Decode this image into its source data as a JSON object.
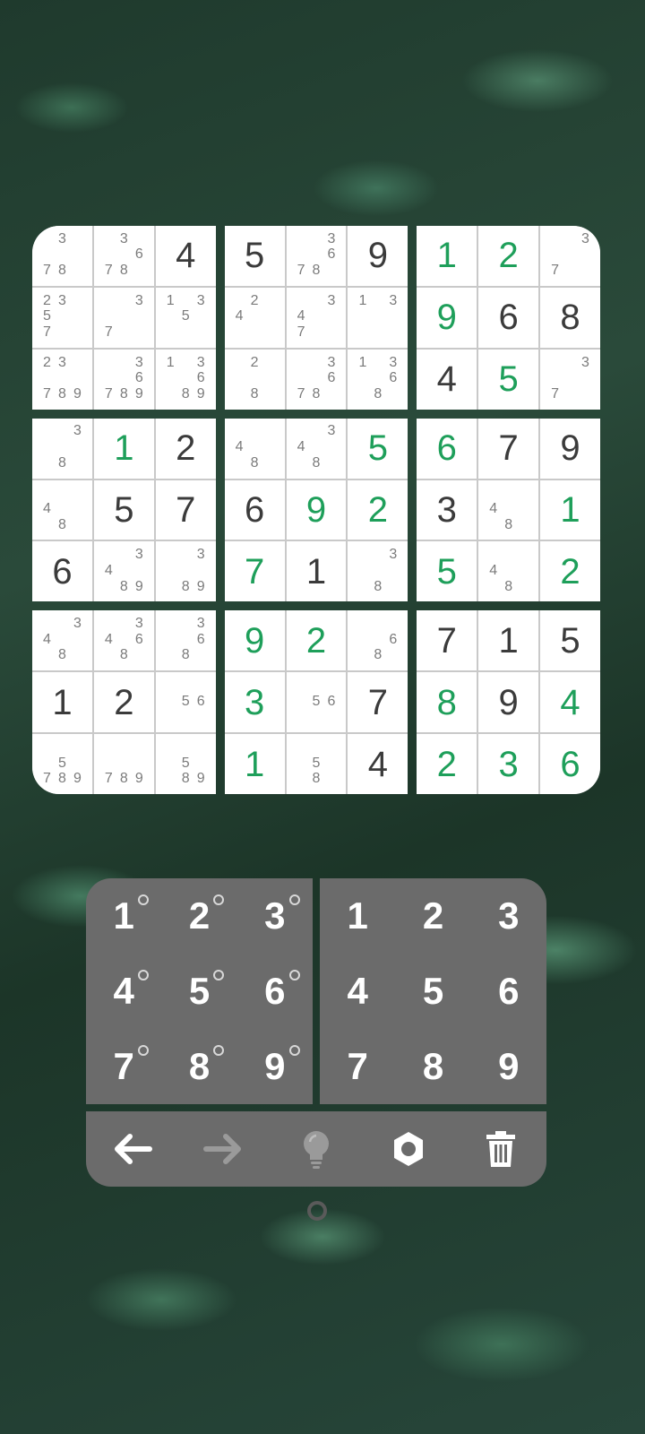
{
  "board": [
    [
      {
        "notes": [
          "",
          "3",
          "",
          "",
          "",
          "",
          "7",
          "8",
          ""
        ]
      },
      {
        "notes": [
          "",
          "3",
          "",
          "",
          "",
          "6",
          "7",
          "8",
          ""
        ]
      },
      {
        "value": "4",
        "kind": "given"
      },
      {
        "notes": [
          "2",
          "3",
          "",
          "5",
          "",
          "",
          "7",
          "",
          ""
        ]
      },
      {
        "notes": [
          "",
          "",
          "3",
          "",
          "",
          "",
          "7",
          "",
          ""
        ]
      },
      {
        "notes": [
          "1",
          "",
          "3",
          "",
          "5",
          "",
          "",
          "",
          ""
        ]
      },
      {
        "notes": [
          "2",
          "3",
          "",
          "",
          "",
          "",
          "7",
          "8",
          "9"
        ]
      },
      {
        "notes": [
          "",
          "",
          "3",
          "",
          "",
          "6",
          "7",
          "8",
          "9"
        ]
      },
      {
        "notes": [
          "1",
          "",
          "3",
          "",
          "",
          "6",
          "",
          "8",
          "9"
        ]
      }
    ],
    [
      {
        "value": "5",
        "kind": "given"
      },
      {
        "notes": [
          "",
          "",
          "3",
          "",
          "",
          "6",
          "7",
          "8",
          ""
        ]
      },
      {
        "value": "9",
        "kind": "given"
      },
      {
        "notes": [
          "",
          "2",
          "",
          "4",
          "",
          "",
          "",
          "",
          ""
        ]
      },
      {
        "notes": [
          "",
          "",
          "3",
          "4",
          "",
          "",
          "7",
          "",
          ""
        ]
      },
      {
        "notes": [
          "1",
          "",
          "3",
          "",
          "",
          "",
          "",
          "",
          ""
        ]
      },
      {
        "notes": [
          "",
          "2",
          "",
          "",
          "",
          "",
          "",
          "8",
          ""
        ]
      },
      {
        "notes": [
          "",
          "",
          "3",
          "",
          "",
          "6",
          "7",
          "8",
          ""
        ]
      },
      {
        "notes": [
          "1",
          "",
          "3",
          "",
          "",
          "6",
          "",
          "8",
          ""
        ]
      }
    ],
    [
      {
        "value": "1",
        "kind": "user"
      },
      {
        "value": "2",
        "kind": "user"
      },
      {
        "notes": [
          "",
          "",
          "3",
          "",
          "",
          "",
          "7",
          "",
          ""
        ]
      },
      {
        "value": "9",
        "kind": "user"
      },
      {
        "value": "6",
        "kind": "given"
      },
      {
        "value": "8",
        "kind": "given"
      },
      {
        "value": "4",
        "kind": "given"
      },
      {
        "value": "5",
        "kind": "user"
      },
      {
        "notes": [
          "",
          "",
          "3",
          "",
          "",
          "",
          "7",
          "",
          ""
        ]
      }
    ],
    [
      {
        "notes": [
          "",
          "",
          "3",
          "",
          "",
          "",
          "",
          "8",
          ""
        ]
      },
      {
        "value": "1",
        "kind": "user"
      },
      {
        "value": "2",
        "kind": "given"
      },
      {
        "notes": [
          "",
          "",
          "",
          "4",
          "",
          "",
          "",
          "8",
          ""
        ]
      },
      {
        "value": "5",
        "kind": "given"
      },
      {
        "value": "7",
        "kind": "given"
      },
      {
        "value": "6",
        "kind": "given"
      },
      {
        "notes": [
          "",
          "",
          "3",
          "4",
          "",
          "",
          "",
          "8",
          "9"
        ]
      },
      {
        "notes": [
          "",
          "",
          "3",
          "",
          "",
          "",
          "",
          "8",
          "9"
        ]
      }
    ],
    [
      {
        "notes": [
          "",
          "",
          "",
          "4",
          "",
          "",
          "",
          "8",
          ""
        ]
      },
      {
        "notes": [
          "",
          "",
          "3",
          "4",
          "",
          "",
          "",
          "8",
          ""
        ]
      },
      {
        "value": "5",
        "kind": "user"
      },
      {
        "value": "6",
        "kind": "given"
      },
      {
        "value": "9",
        "kind": "user"
      },
      {
        "value": "2",
        "kind": "user"
      },
      {
        "value": "7",
        "kind": "user"
      },
      {
        "value": "1",
        "kind": "given"
      },
      {
        "notes": [
          "",
          "",
          "3",
          "",
          "",
          "",
          "",
          "8",
          ""
        ]
      }
    ],
    [
      {
        "value": "6",
        "kind": "user"
      },
      {
        "value": "7",
        "kind": "given"
      },
      {
        "value": "9",
        "kind": "given"
      },
      {
        "value": "3",
        "kind": "given"
      },
      {
        "notes": [
          "",
          "",
          "",
          "4",
          "",
          "",
          "",
          "8",
          ""
        ]
      },
      {
        "value": "1",
        "kind": "user"
      },
      {
        "value": "5",
        "kind": "user"
      },
      {
        "notes": [
          "",
          "",
          "",
          "4",
          "",
          "",
          "",
          "8",
          ""
        ]
      },
      {
        "value": "2",
        "kind": "user"
      }
    ],
    [
      {
        "notes": [
          "",
          "",
          "3",
          "4",
          "",
          "",
          "",
          "8",
          ""
        ]
      },
      {
        "notes": [
          "",
          "",
          "3",
          "4",
          "",
          "6",
          "",
          "8",
          ""
        ]
      },
      {
        "notes": [
          "",
          "",
          "3",
          "",
          "",
          "6",
          "",
          "8",
          ""
        ]
      },
      {
        "value": "1",
        "kind": "given"
      },
      {
        "value": "2",
        "kind": "given"
      },
      {
        "notes": [
          "",
          "",
          "",
          "",
          "5",
          "6",
          "",
          "",
          ""
        ]
      },
      {
        "notes": [
          "",
          "",
          "",
          "",
          "5",
          "",
          "7",
          "8",
          "9"
        ]
      },
      {
        "notes": [
          "",
          "",
          "",
          "",
          "",
          "",
          "7",
          "8",
          "9"
        ]
      },
      {
        "notes": [
          "",
          "",
          "",
          "",
          "5",
          "",
          "",
          "8",
          "9"
        ]
      }
    ],
    [
      {
        "value": "9",
        "kind": "user"
      },
      {
        "value": "2",
        "kind": "user"
      },
      {
        "notes": [
          "",
          "",
          "",
          "",
          "",
          "6",
          "",
          "8",
          ""
        ]
      },
      {
        "value": "3",
        "kind": "user"
      },
      {
        "notes": [
          "",
          "",
          "",
          "",
          "5",
          "6",
          "",
          "",
          ""
        ]
      },
      {
        "value": "7",
        "kind": "given"
      },
      {
        "value": "1",
        "kind": "user"
      },
      {
        "notes": [
          "",
          "",
          "",
          "",
          "5",
          "",
          "",
          "8",
          ""
        ]
      },
      {
        "value": "4",
        "kind": "given"
      }
    ],
    [
      {
        "value": "7",
        "kind": "given"
      },
      {
        "value": "1",
        "kind": "given"
      },
      {
        "value": "5",
        "kind": "given"
      },
      {
        "value": "8",
        "kind": "user"
      },
      {
        "value": "9",
        "kind": "given"
      },
      {
        "value": "4",
        "kind": "user"
      },
      {
        "value": "2",
        "kind": "user"
      },
      {
        "value": "3",
        "kind": "user"
      },
      {
        "value": "6",
        "kind": "user"
      }
    ]
  ],
  "notes_pad": [
    "1",
    "2",
    "3",
    "4",
    "5",
    "6",
    "7",
    "8",
    "9"
  ],
  "value_pad": [
    "1",
    "2",
    "3",
    "4",
    "5",
    "6",
    "7",
    "8",
    "9"
  ],
  "toolbar": [
    {
      "icon": "undo-arrow-icon",
      "color": "#ffffff"
    },
    {
      "icon": "redo-arrow-icon",
      "color": "#9a9a9a"
    },
    {
      "icon": "hint-lightbulb-icon",
      "color": "#9a9a9a"
    },
    {
      "icon": "settings-gear-icon",
      "color": "#ffffff"
    },
    {
      "icon": "delete-trash-icon",
      "color": "#ffffff"
    }
  ],
  "colors": {
    "given": "#3b3b3b",
    "user": "#1e9f5a",
    "note": "#7b7b7b",
    "pad": "#6b6b6b"
  }
}
